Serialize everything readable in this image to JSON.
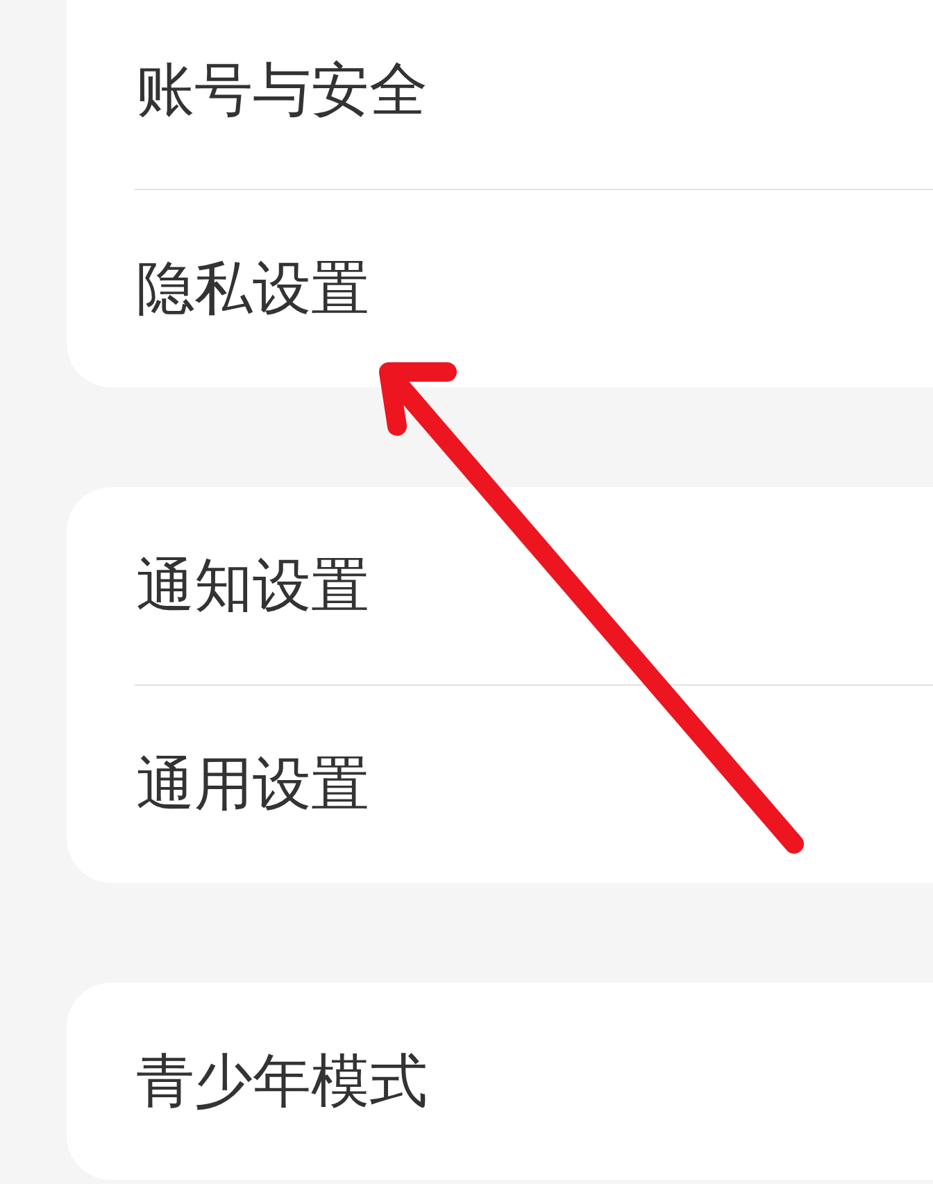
{
  "sections": [
    {
      "items": [
        "账号与安全",
        "隐私设置"
      ]
    },
    {
      "items": [
        "通知设置",
        "通用设置"
      ]
    },
    {
      "items": [
        "青少年模式"
      ]
    }
  ]
}
